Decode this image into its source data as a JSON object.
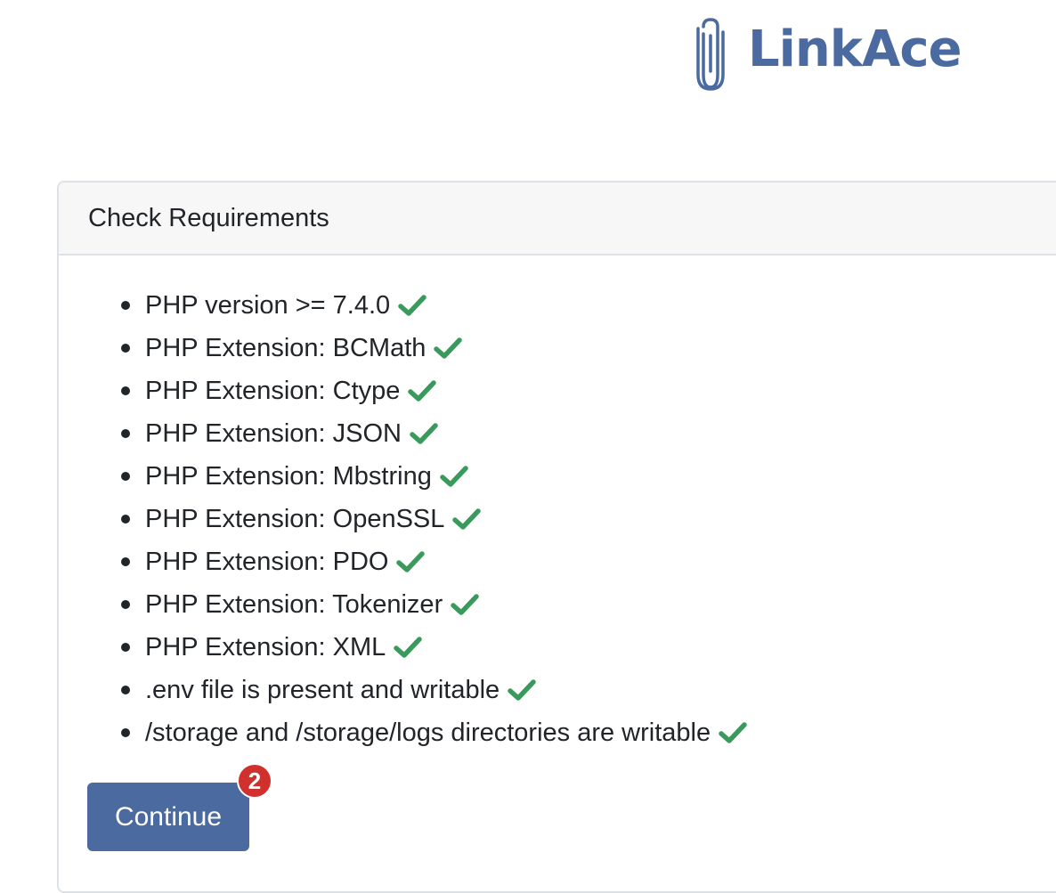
{
  "app": {
    "logo_text": "LinkAce",
    "logo_icon": "paperclip-icon",
    "brand_color": "#4a6aa0"
  },
  "card": {
    "title": "Check Requirements",
    "requirements": [
      {
        "label": "PHP version >= 7.4.0",
        "status": "passed",
        "icon": "check-icon"
      },
      {
        "label": "PHP Extension: BCMath",
        "status": "passed",
        "icon": "check-icon"
      },
      {
        "label": "PHP Extension: Ctype",
        "status": "passed",
        "icon": "check-icon"
      },
      {
        "label": "PHP Extension: JSON",
        "status": "passed",
        "icon": "check-icon"
      },
      {
        "label": "PHP Extension: Mbstring",
        "status": "passed",
        "icon": "check-icon"
      },
      {
        "label": "PHP Extension: OpenSSL",
        "status": "passed",
        "icon": "check-icon"
      },
      {
        "label": "PHP Extension: PDO",
        "status": "passed",
        "icon": "check-icon"
      },
      {
        "label": "PHP Extension: Tokenizer",
        "status": "passed",
        "icon": "check-icon"
      },
      {
        "label": "PHP Extension: XML",
        "status": "passed",
        "icon": "check-icon"
      },
      {
        "label": ".env file is present and writable",
        "status": "passed",
        "icon": "check-icon"
      },
      {
        "label": "/storage and /storage/logs directories are writable",
        "status": "passed",
        "icon": "check-icon"
      }
    ],
    "check_color": "#3a9a5b"
  },
  "actions": {
    "continue_label": "Continue",
    "badge_count": "2",
    "badge_color": "#d0312d"
  }
}
